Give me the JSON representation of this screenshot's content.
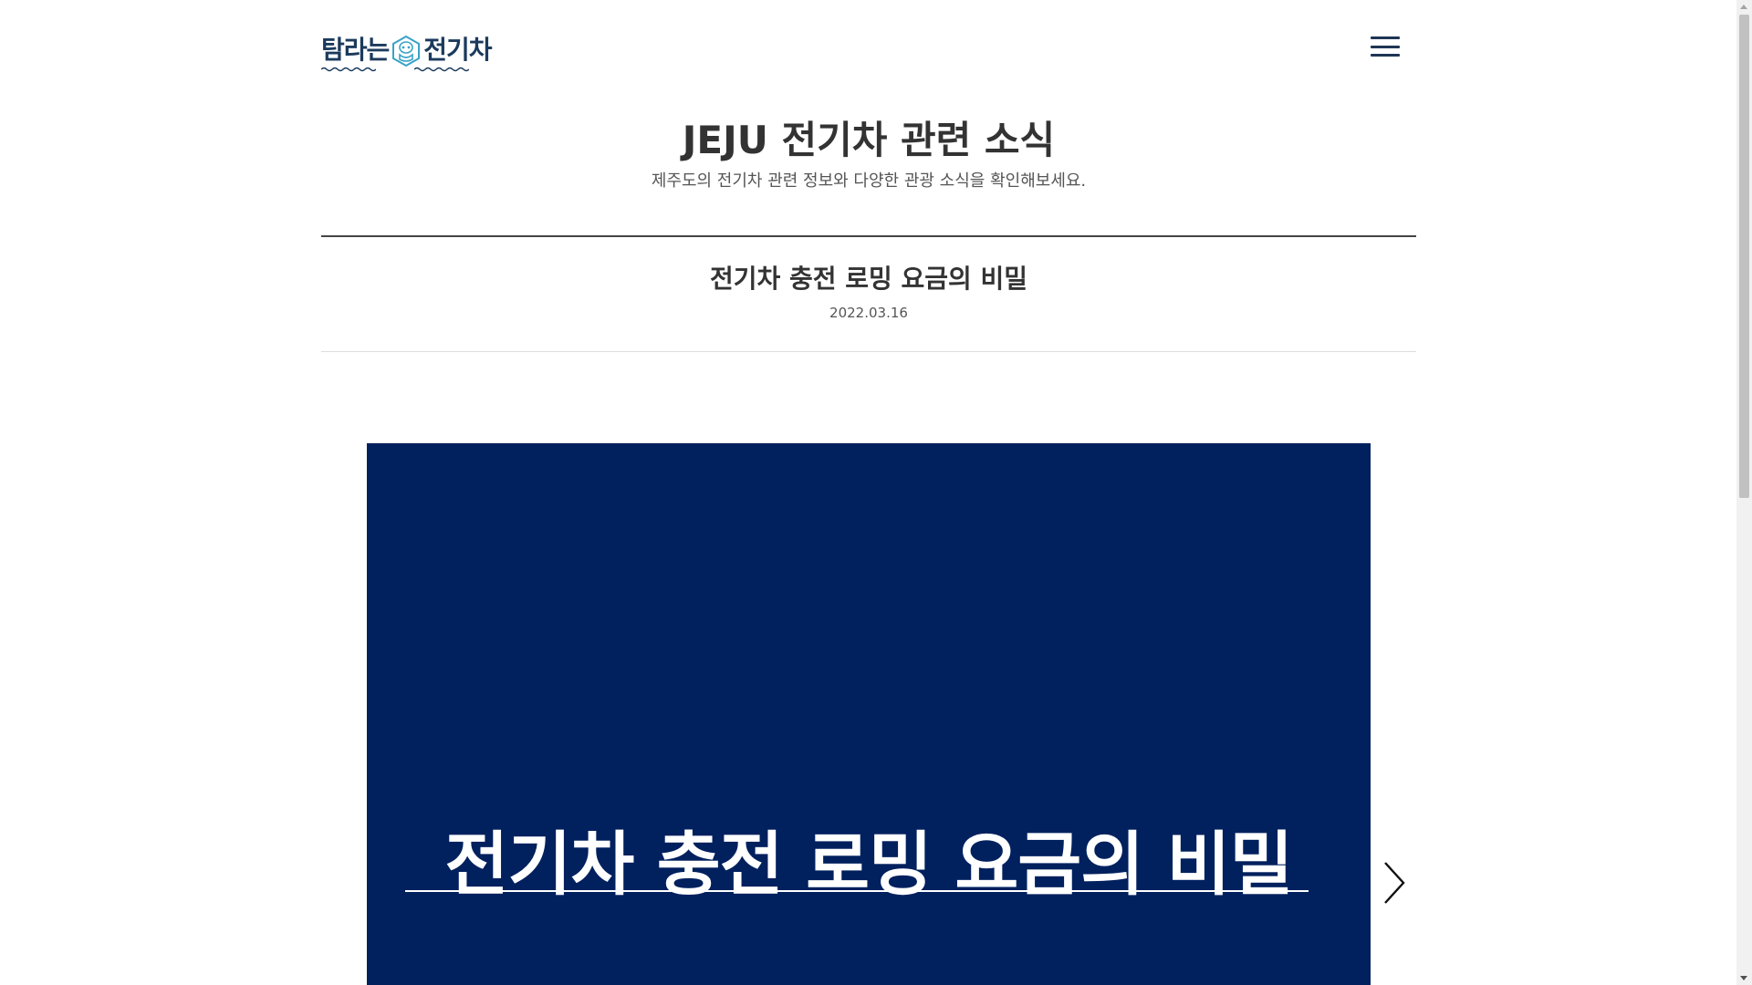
{
  "header": {
    "logo_text_left": "탐라는",
    "logo_text_right": "전기차",
    "logo_icon": "harubang-emblem-icon",
    "menu_icon": "hamburger-menu-icon"
  },
  "intro": {
    "title": "JEJU 전기차 관련 소식",
    "subtitle": "제주도의 전기차 관련 정보와 다양한 관광 소식을 확인해보세요."
  },
  "article": {
    "title": "전기차 충전 로밍 요금의 비밀",
    "date": "2022.03.16"
  },
  "slide": {
    "heading": "전기차 충전 로밍 요금의 비밀",
    "next_icon": "chevron-right-icon"
  },
  "colors": {
    "slide_background": "#00205e",
    "logo_color": "#1b3a5c",
    "emblem_accent": "#3aa3c8"
  }
}
